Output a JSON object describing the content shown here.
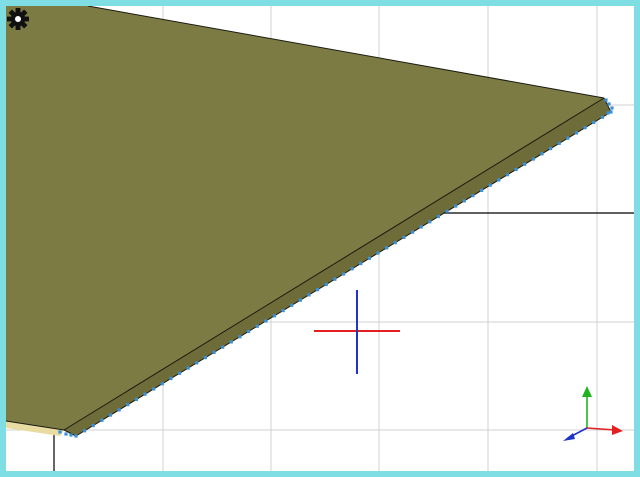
{
  "viewport": {
    "icons": {
      "settings": "gear-icon",
      "origin": "crosshair-icon",
      "axes": "axis-triad-icon"
    },
    "colors": {
      "frame": "#7fdde4",
      "grid": "#d2d2d2",
      "grid_major": "#000000",
      "surface_top": "#7c7b43",
      "surface_edge": "#6e6c38",
      "outline": "#1b1b12",
      "underside": "#e9dca2",
      "control_points": "#3a8fd6",
      "axis_x": "#e41f1f",
      "axis_y": "#1fb41f",
      "axis_z": "#1f34c8",
      "gear": "#111111"
    }
  }
}
